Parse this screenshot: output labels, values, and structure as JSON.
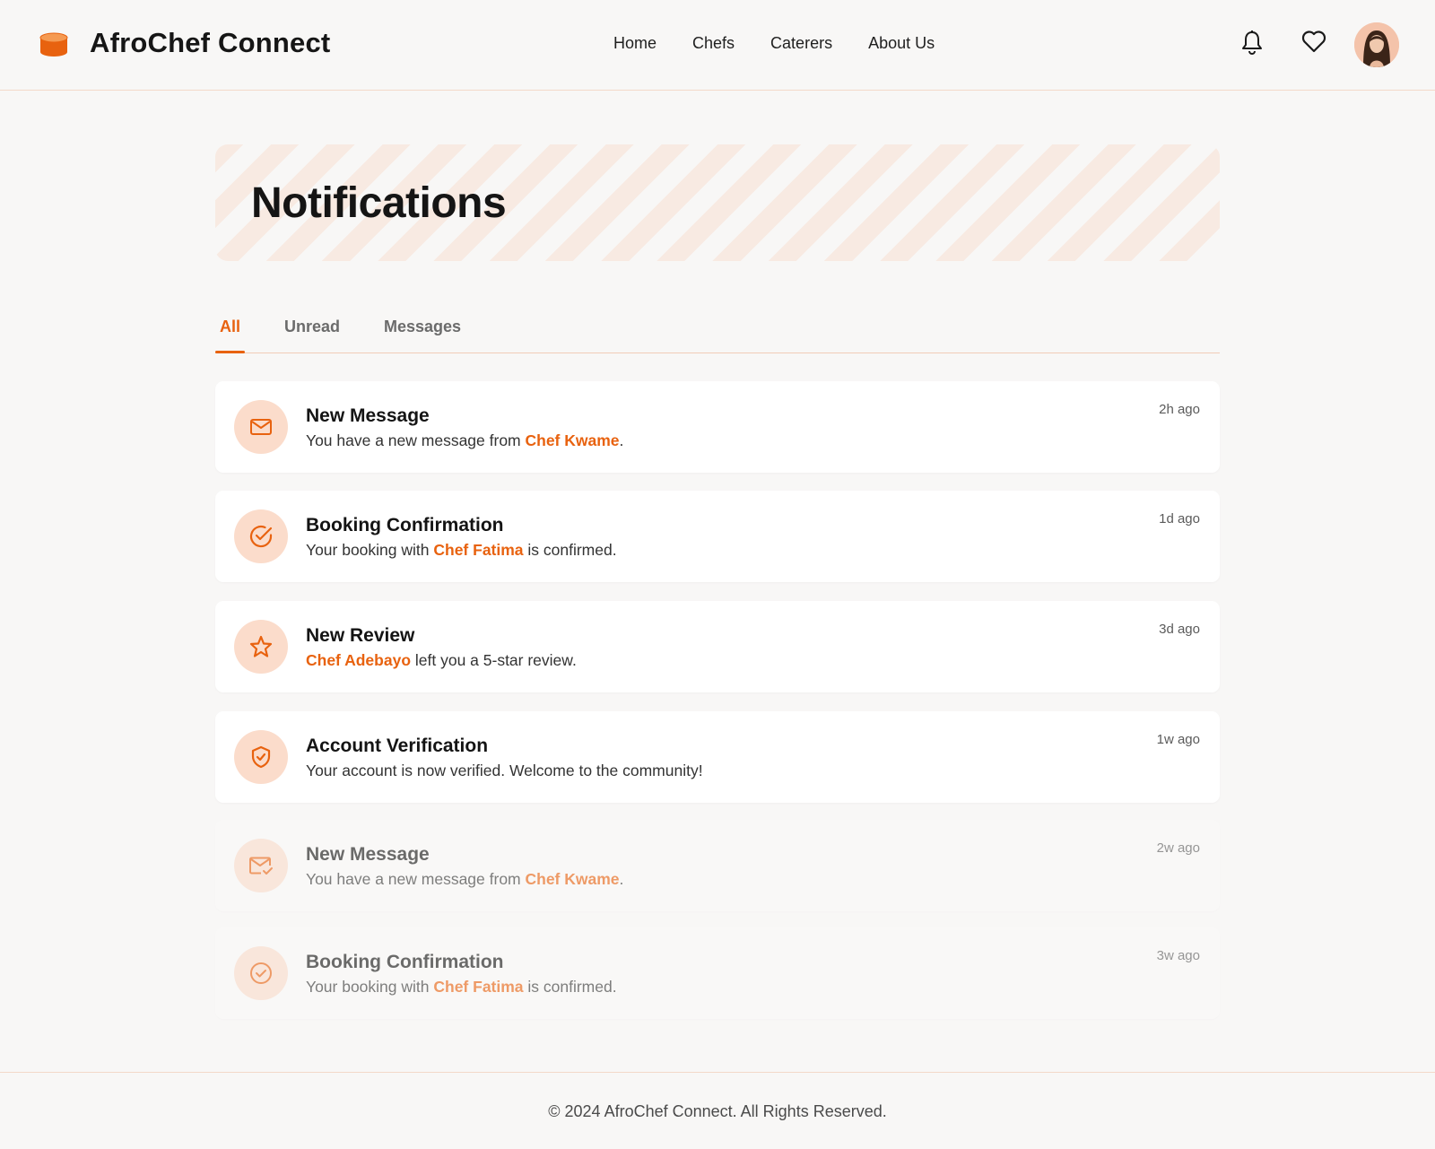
{
  "header": {
    "brand": "AfroChef Connect",
    "nav": [
      "Home",
      "Chefs",
      "Caterers",
      "About Us"
    ]
  },
  "page": {
    "title": "Notifications"
  },
  "tabs": [
    "All",
    "Unread",
    "Messages"
  ],
  "notifications": [
    {
      "icon": "mail-icon",
      "title": "New Message",
      "pre": "You have a new message from ",
      "highlight": "Chef Kwame",
      "post": ".",
      "time": "2h ago"
    },
    {
      "icon": "check-circle-icon",
      "title": "Booking Confirmation",
      "pre": "Your booking with ",
      "highlight": "Chef Fatima",
      "post": " is confirmed.",
      "time": "1d ago"
    },
    {
      "icon": "star-icon",
      "title": "New Review",
      "pre": "",
      "highlight": "Chef Adebayo",
      "post": " left you a 5-star review.",
      "time": "3d ago"
    },
    {
      "icon": "shield-check-icon",
      "title": "Account Verification",
      "pre": "Your account is now verified. Welcome to the community!",
      "highlight": "",
      "post": "",
      "time": "1w ago"
    },
    {
      "icon": "mail-check-icon",
      "title": "New Message",
      "pre": "You have a new message from ",
      "highlight": "Chef Kwame",
      "post": ".",
      "time": "2w ago"
    },
    {
      "icon": "check-circle-icon",
      "title": "Booking Confirmation",
      "pre": "Your booking with ",
      "highlight": "Chef Fatima",
      "post": " is confirmed.",
      "time": "3w ago"
    }
  ],
  "footer": {
    "text": "© 2024 AfroChef Connect. All Rights Reserved."
  },
  "colors": {
    "accent": "#e8620f",
    "icon_bg": "#fbdccb",
    "background": "#f8f7f6"
  }
}
